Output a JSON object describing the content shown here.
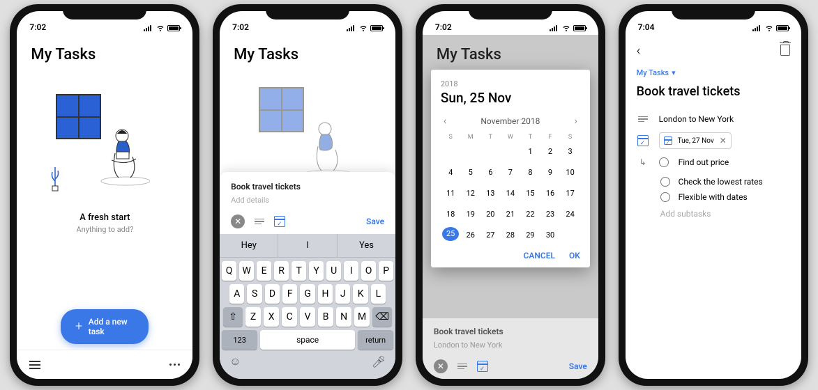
{
  "statusbar": {
    "time1": "7:02",
    "time2": "7:04"
  },
  "screen1": {
    "title": "My Tasks",
    "fresh_title": "A fresh start",
    "fresh_sub": "Anything to add?",
    "add_btn": "Add a new task"
  },
  "screen2": {
    "title": "My Tasks",
    "sheet_title": "Book travel tickets",
    "sheet_details_ph": "Add details",
    "save": "Save",
    "keyboard": {
      "suggest": [
        "Hey",
        "I",
        "Yes"
      ],
      "row1": [
        "Q",
        "W",
        "E",
        "R",
        "T",
        "Y",
        "U",
        "I",
        "O",
        "P"
      ],
      "row2": [
        "A",
        "S",
        "D",
        "F",
        "G",
        "H",
        "J",
        "K",
        "L"
      ],
      "row3": [
        "Z",
        "X",
        "C",
        "V",
        "B",
        "N",
        "M"
      ],
      "k123": "123",
      "space": "space",
      "ret": "return"
    }
  },
  "screen3": {
    "title": "My Tasks",
    "year": "2018",
    "date_label": "Sun, 25 Nov",
    "month": "November 2018",
    "dayheads": [
      "S",
      "M",
      "T",
      "W",
      "T",
      "F",
      "S"
    ],
    "grid": [
      "",
      "",
      "",
      "",
      "1",
      "2",
      "3",
      "4",
      "5",
      "6",
      "7",
      "8",
      "9",
      "10",
      "11",
      "12",
      "13",
      "14",
      "15",
      "16",
      "17",
      "18",
      "19",
      "20",
      "21",
      "22",
      "23",
      "24",
      "25",
      "26",
      "27",
      "28",
      "29",
      "30",
      ""
    ],
    "selected_index": 28,
    "cancel": "CANCEL",
    "ok": "OK",
    "sheet_title": "Book travel tickets",
    "sheet_sub": "London to New York",
    "save": "Save"
  },
  "screen4": {
    "crumb": "My Tasks",
    "title": "Book travel tickets",
    "desc": "London to New York",
    "date_chip": "Tue, 27 Nov",
    "subtasks": [
      "Find out price",
      "Check the lowest rates",
      "Flexible with dates"
    ],
    "add_sub": "Add subtasks"
  }
}
